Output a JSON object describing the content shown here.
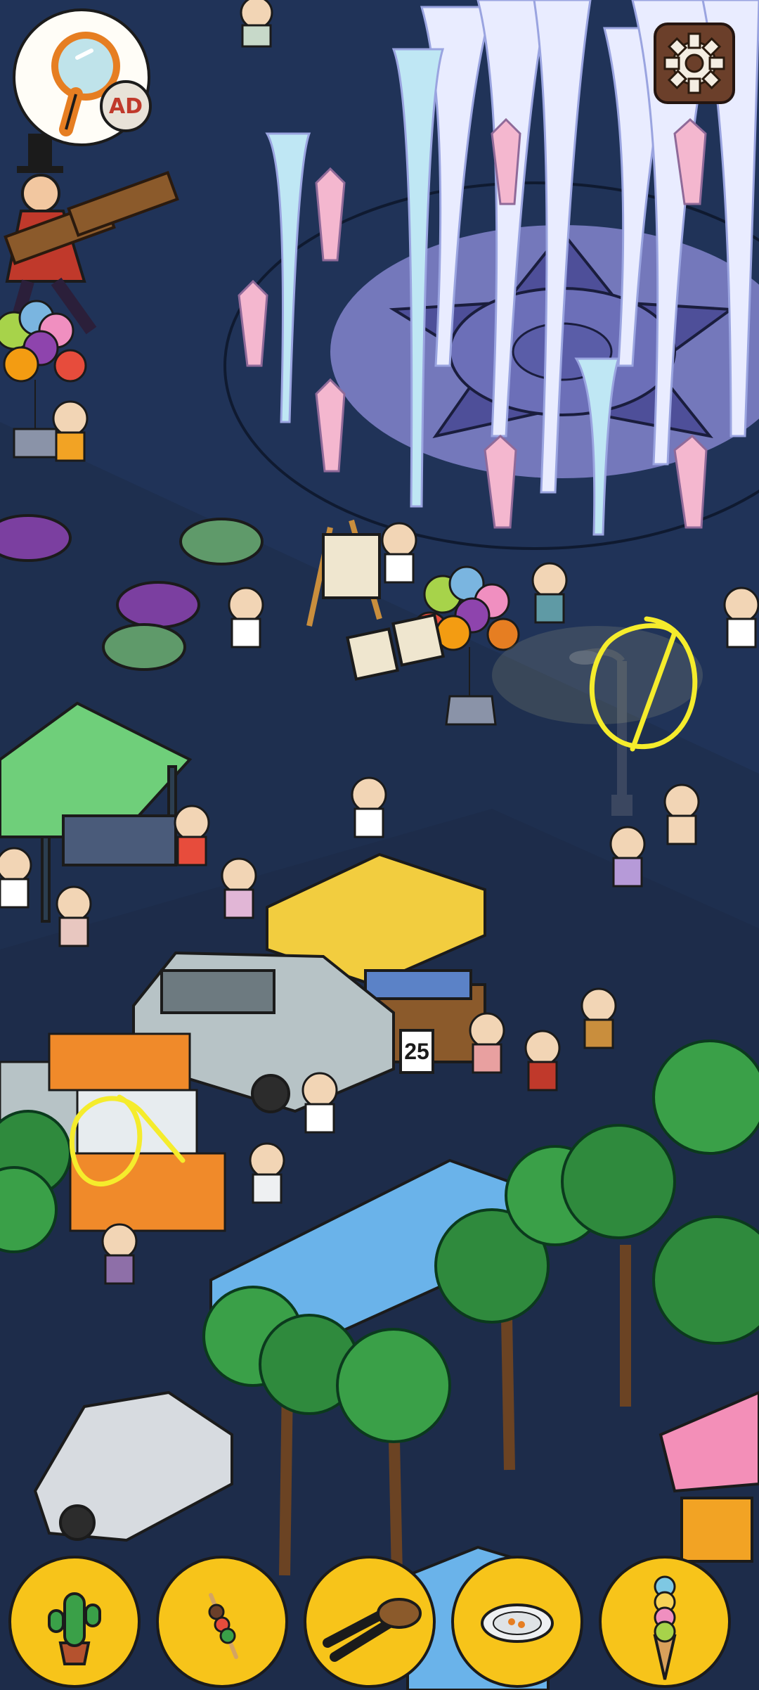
{
  "hud": {
    "hint_button": {
      "icon": "magnifier-icon",
      "badge_label": "AD"
    },
    "settings_button": {
      "icon": "gear-icon"
    }
  },
  "scene": {
    "signs": {
      "stall_number": "25"
    },
    "found_markers": [
      {
        "name": "streetlamp-circle",
        "color": "#f5ec2c"
      },
      {
        "name": "stall-tongs-circle",
        "color": "#f5ec2c"
      }
    ]
  },
  "item_bar": {
    "slots": [
      {
        "icon": "cactus-icon"
      },
      {
        "icon": "skewer-icon"
      },
      {
        "icon": "tongs-icon"
      },
      {
        "icon": "plate-icon"
      },
      {
        "icon": "ice-cream-cone-icon"
      }
    ]
  },
  "colors": {
    "ground": "#1e2f4f",
    "plaza": "#243a63",
    "item_slot": "#f7c41a",
    "marker": "#f5ec2c"
  }
}
